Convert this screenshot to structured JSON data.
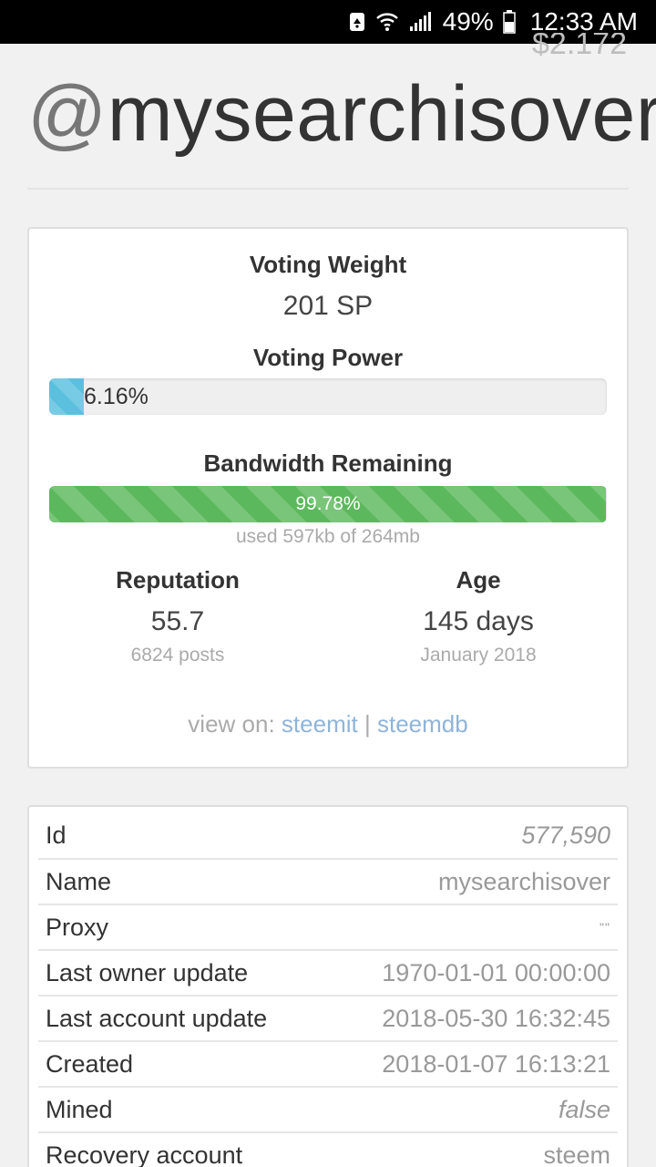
{
  "status_bar": {
    "battery": "49%",
    "time": "12:33 AM",
    "icons": [
      "notification-icon",
      "wifi-icon",
      "signal-icon",
      "battery-icon"
    ]
  },
  "header": {
    "price_peek": "$2.172",
    "at": "@",
    "username": "mysearchisover"
  },
  "stats": {
    "voting_weight_label": "Voting Weight",
    "voting_weight_value": "201 SP",
    "voting_power_label": "Voting Power",
    "voting_power_text": "6.16%",
    "voting_power_fraction": 0.0616,
    "bandwidth_label": "Bandwidth Remaining",
    "bandwidth_text": "99.78%",
    "bandwidth_fraction": 0.9978,
    "bandwidth_used": "used 597kb of 264mb",
    "reputation_label": "Reputation",
    "reputation_value": "55.7",
    "posts": "6824 posts",
    "age_label": "Age",
    "age_value": "145 days",
    "age_since": "January 2018",
    "view_on_label": "view on:",
    "link_steemit": "steemit",
    "separator": "|",
    "link_steemdb": "steemdb"
  },
  "colors": {
    "voting_bar": "#5bc0de",
    "bandwidth_bar": "#5cb85c",
    "link": "#8fb4d9"
  },
  "properties": [
    {
      "label": "Id",
      "value": "577,590",
      "italic": true
    },
    {
      "label": "Name",
      "value": "mysearchisover",
      "italic": false
    },
    {
      "label": "Proxy",
      "value": "\"\"",
      "italic": false
    },
    {
      "label": "Last owner update",
      "value": "1970-01-01 00:00:00",
      "italic": false
    },
    {
      "label": "Last account update",
      "value": "2018-05-30 16:32:45",
      "italic": false
    },
    {
      "label": "Created",
      "value": "2018-01-07 16:13:21",
      "italic": false
    },
    {
      "label": "Mined",
      "value": "false",
      "italic": true
    },
    {
      "label": "Recovery account",
      "value": "steem",
      "italic": false
    }
  ]
}
